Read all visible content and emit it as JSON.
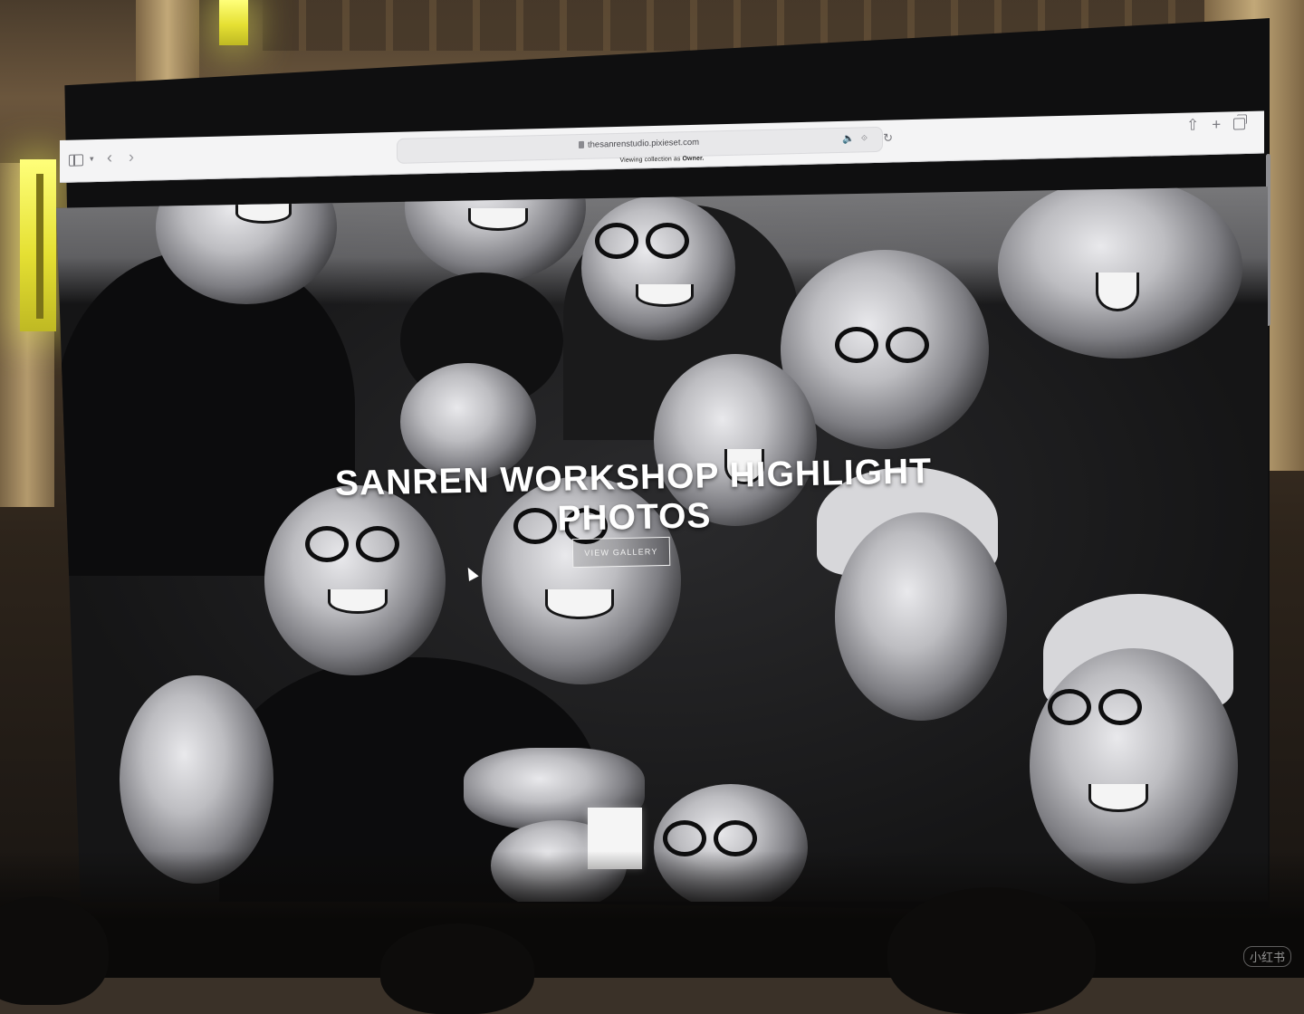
{
  "browser": {
    "url": "thesanrenstudio.pixieset.com",
    "banner_prefix": "Viewing collection as",
    "banner_role": "Owner."
  },
  "hero": {
    "title": "SANREN WORKSHOP HIGHLIGHT PHOTOS",
    "button_label": "VIEW GALLERY"
  },
  "watermark": "小红书",
  "icons": {
    "sidebar": "sidebar-toggle-icon",
    "back": "chevron-left-icon",
    "forward": "chevron-right-icon",
    "share": "share-icon",
    "new_tab": "plus-icon",
    "tabs": "tabs-overview-icon",
    "audio": "speaker-icon",
    "reload": "reload-icon"
  },
  "colors": {
    "toolbar": "#f4f4f5",
    "hero_overlay_text": "#ffffff",
    "room_light": "#e5e033"
  }
}
